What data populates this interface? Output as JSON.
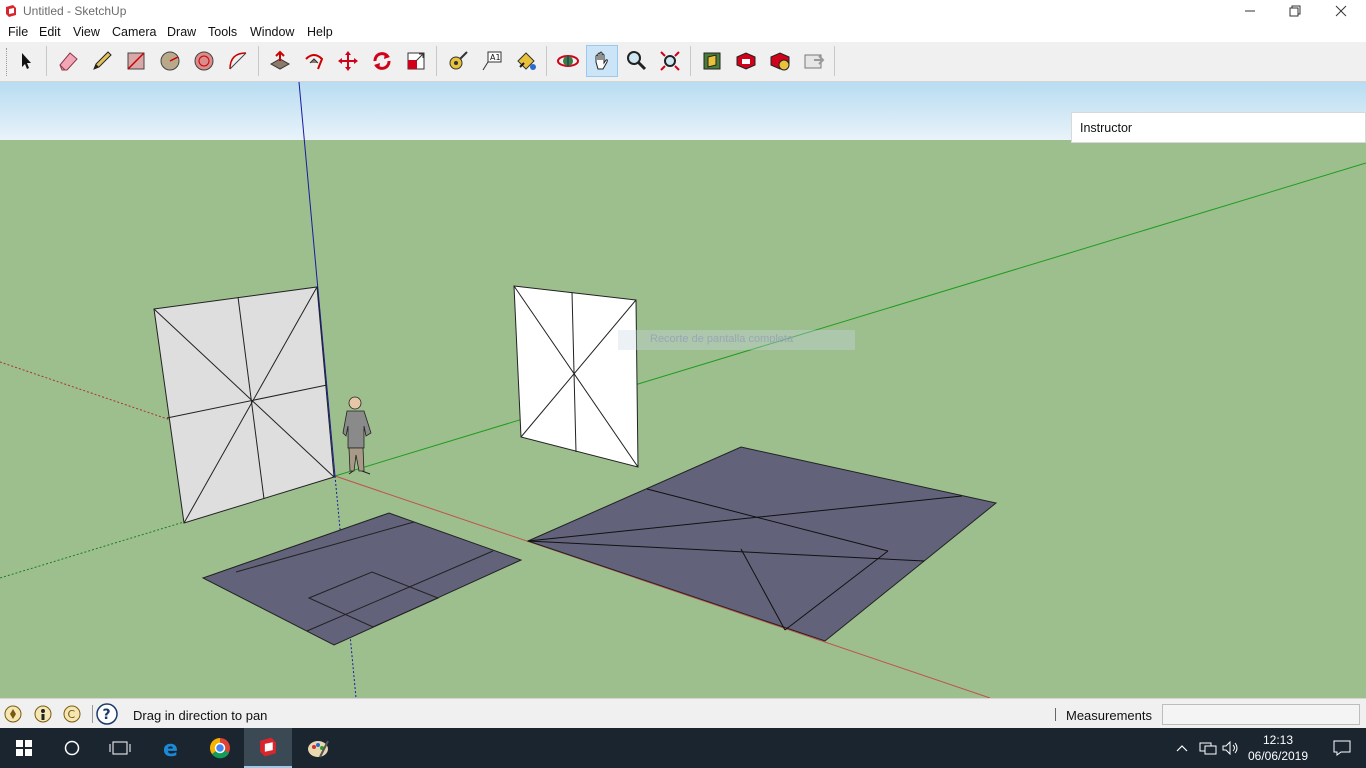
{
  "titlebar": {
    "title": "Untitled - SketchUp",
    "buttons": [
      "minimize",
      "restore",
      "close"
    ]
  },
  "menu": [
    "File",
    "Edit",
    "View",
    "Camera",
    "Draw",
    "Tools",
    "Window",
    "Help"
  ],
  "toolbar": {
    "tools": [
      "select-icon",
      "eraser-icon",
      "pencil-icon",
      "rectangle-icon",
      "circle-icon",
      "polygon-icon",
      "arc-icon",
      "push-pull-icon",
      "follow-me-icon",
      "move-icon",
      "rotate-icon",
      "scale-icon",
      "tape-measure-icon",
      "text-icon",
      "paint-bucket-icon",
      "orbit-icon",
      "pan-icon",
      "zoom-icon",
      "zoom-extents-icon",
      "3d-warehouse-icon",
      "extension-warehouse-icon",
      "extension-manager-icon",
      "send-to-layout-icon"
    ],
    "active_tool": "pan-icon"
  },
  "viewport": {
    "sky_color": "#cfe6f3",
    "ground_color": "#9dbf8e",
    "axis_colors": {
      "red": "#c0504d",
      "green": "#1f9c1f",
      "blue": "#1a1aa0"
    },
    "overlay_text": "Recorte de pantalla completa"
  },
  "instructor": {
    "label": "Instructor"
  },
  "status": {
    "icons": [
      "geolocation-icon",
      "credits-icon",
      "copyright-icon",
      "help-icon"
    ],
    "message": "Drag in direction to pan",
    "measurements_label": "Measurements",
    "measurements_value": ""
  },
  "taskbar": {
    "apps": [
      "windows-start-icon",
      "search-icon",
      "task-view-icon",
      "edge-icon",
      "chrome-icon",
      "sketchup-icon",
      "paint-icon"
    ],
    "time": "12:13",
    "date": "06/06/2019"
  }
}
